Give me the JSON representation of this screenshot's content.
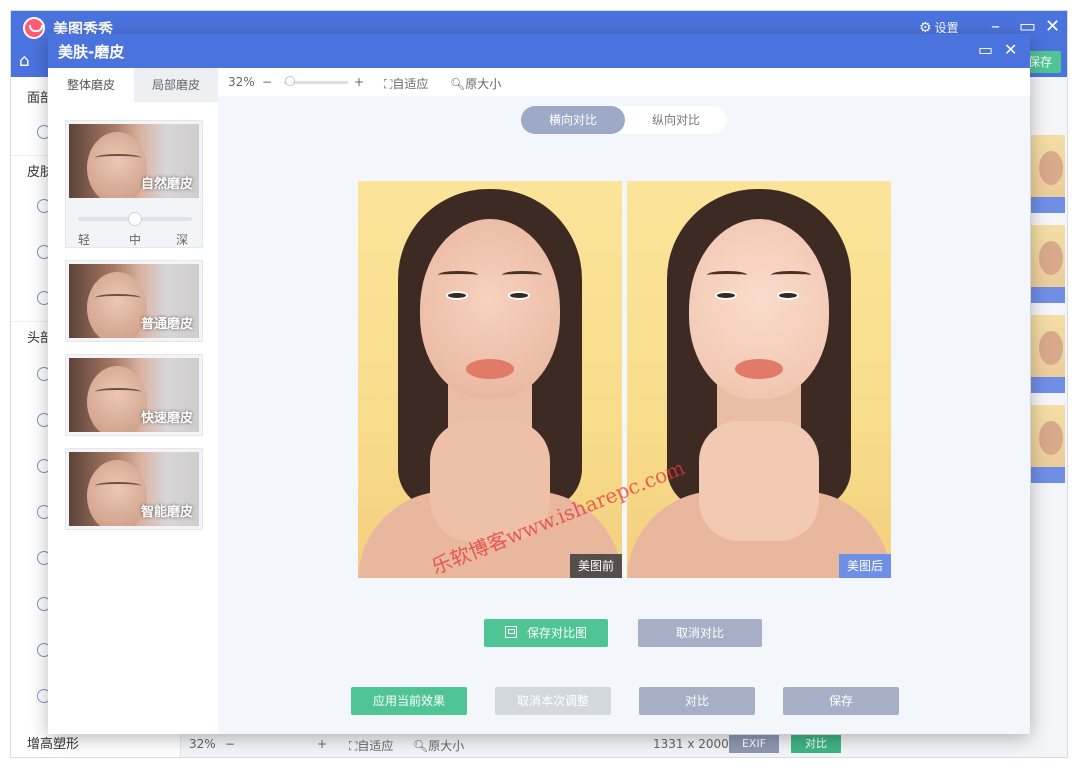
{
  "background_window": {
    "app_title": "美图秀秀",
    "settings_label": "设置",
    "save_label": "保存",
    "sidebar_sections": [
      "面部",
      "皮肤",
      "头部",
      "增高塑形"
    ],
    "status": {
      "zoom": "32%",
      "fit_label": "自适应",
      "original_size_label": "原大小",
      "dimensions": "1331 x 2000",
      "exif_label": "EXIF",
      "compare_label": "对比"
    }
  },
  "dialog": {
    "title": "美肤-磨皮",
    "tabs": [
      {
        "label": "整体磨皮",
        "active": true
      },
      {
        "label": "局部磨皮",
        "active": false
      }
    ],
    "presets": [
      {
        "label": "自然磨皮",
        "selected": true
      },
      {
        "label": "普通磨皮",
        "selected": false
      },
      {
        "label": "快速磨皮",
        "selected": false
      },
      {
        "label": "智能磨皮",
        "selected": false
      }
    ],
    "intensity": {
      "labels": [
        "轻",
        "中",
        "深"
      ],
      "value": 0.5
    },
    "toolbar": {
      "zoom": "32%",
      "zoom_out": "−",
      "zoom_in": "+",
      "fit_label": "自适应",
      "original_size_label": "原大小",
      "zoom_slider_value": 0.1
    },
    "compare_modes": [
      {
        "label": "横向对比",
        "active": true
      },
      {
        "label": "纵向对比",
        "active": false
      }
    ],
    "before_tag": "美图前",
    "after_tag": "美图后",
    "watermark": "乐软博客www.isharepc.com",
    "buttons": {
      "save_compare": "保存对比图",
      "cancel_compare": "取消对比",
      "apply": "应用当前效果",
      "undo": "取消本次调整",
      "compare": "对比",
      "save": "保存"
    }
  },
  "colors": {
    "titlebar": "#4b73de",
    "primary_green": "#4fc595",
    "muted_button": "#a7afc7",
    "after_tag": "#6f8ee6"
  }
}
